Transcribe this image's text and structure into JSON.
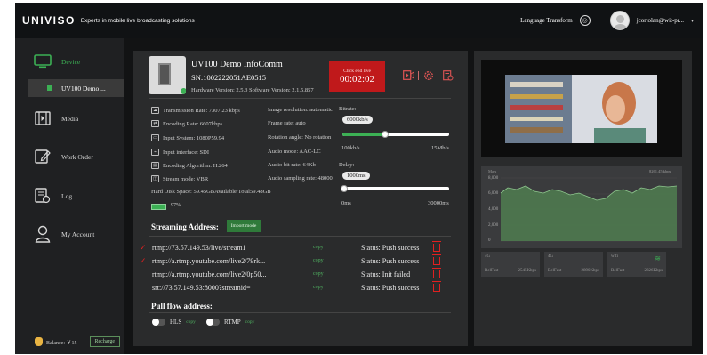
{
  "topbar": {
    "logo": "UNIVISO",
    "tagline": "Experts in mobile live broadcasting solutions",
    "language": "Language Transform",
    "username": "jcortolan@wit-pr...",
    "caret": "▾"
  },
  "sidebar": {
    "items": [
      {
        "label": "Device",
        "icon": "monitor-icon"
      },
      {
        "label": "Media",
        "icon": "film-icon"
      },
      {
        "label": "Work Order",
        "icon": "edit-icon"
      },
      {
        "label": "Log",
        "icon": "log-icon"
      },
      {
        "label": "My Account",
        "icon": "user-icon"
      }
    ],
    "sub_item": "UV100 Demo ...",
    "balance_label": "Balance: ￥15",
    "recharge": "Recharge"
  },
  "device": {
    "title": "UV100 Demo InfoComm",
    "sn": "SN:1002222051AE0515",
    "versions": "Hardware Version: 2.5.3   Software Version: 2.1.5.857",
    "live_caption": "Click end live",
    "live_time": "00:02:02"
  },
  "stats": {
    "left": [
      {
        "icon": "transmission-icon",
        "text": "Transmission Rate: 7307.23 kbps"
      },
      {
        "icon": "encoding-icon",
        "text": "Encoding Rate: 6607kbps"
      },
      {
        "icon": "input-system-icon",
        "text": "Input System: 1080P59.94"
      },
      {
        "icon": "input-interface-icon",
        "text": "Input interface: SDI"
      },
      {
        "icon": "encoding-algorithm-icon",
        "text": "Encoding Algorithm: H.264"
      },
      {
        "icon": "stream-mode-icon",
        "text": "Stream mode: VBR"
      }
    ],
    "middle": [
      "Image resolution: automatic",
      "Frame rate: auto",
      "Rotation angle: No rotation",
      "Audio mode: AAC-LC",
      "Audio bit rate: 64Kb",
      "Audio sampling rate: 48000"
    ],
    "disk": "Hard Disk Space: 59.45GBAvailable/Total59.48GB",
    "disk_pct": "97%",
    "disk_fraction": 0.97
  },
  "bitrate": {
    "label": "Bitrate:",
    "value": "6000kb/s",
    "min": "100kb/s",
    "max": "15Mb/s",
    "fraction": 0.4
  },
  "delay": {
    "label": "Delay:",
    "value": "1000ms",
    "min": "0ms",
    "max": "30000ms",
    "fraction": 0.02
  },
  "streaming": {
    "title": "Streaming Address:",
    "import_label": "Import mode",
    "rows": [
      {
        "checked": true,
        "url": "rtmp://73.57.149.53/live/stream1",
        "copy": "copy",
        "status": "Status:  Push success"
      },
      {
        "checked": true,
        "url": "rtmp://a.rtmp.youtube.com/live2/79rk...",
        "copy": "copy",
        "status": "Status:  Push success"
      },
      {
        "checked": false,
        "url": "rtmp://a.rtmp.youtube.com/live2/0p50...",
        "copy": "copy",
        "status": "Status:  Init failed"
      },
      {
        "checked": false,
        "url": "srt://73.57.149.53:8000?streamid=",
        "copy": "copy",
        "status": "Status:  Push success"
      }
    ],
    "check_glyph": "✓"
  },
  "pull": {
    "title": "Pull flow address:",
    "hls": "HLS",
    "rtmp": "RTMP",
    "copy": "copy"
  },
  "monitor": {
    "chart_left_cap": "Mars",
    "chart_right_cap": "8261.45 kbps",
    "y_ticks": [
      "8,000",
      "6,000",
      "4,000",
      "2,000",
      "0"
    ],
    "cards": [
      {
        "top": "4G",
        "left": "BelFast",
        "right": "2545Kbps",
        "icon": "signal-icon"
      },
      {
        "top": "4G",
        "left": "BelFast",
        "right": "2890Kbps",
        "icon": "signal-icon"
      },
      {
        "top": "wifi",
        "left": "BelFast",
        "right": "2826Kbps",
        "icon": "wifi-icon"
      }
    ]
  },
  "colors": {
    "accent": "#3cb054",
    "live": "#c0191b",
    "panel": "#2a2b2c",
    "background": "#121314"
  }
}
